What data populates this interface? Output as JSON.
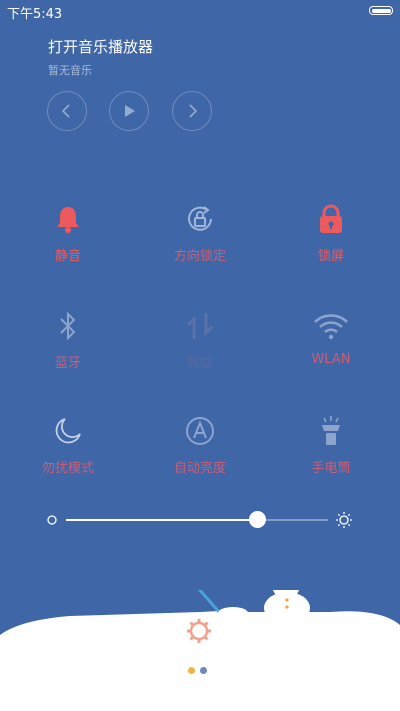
{
  "status_bar": {
    "time": "下午5:43"
  },
  "music": {
    "title": "打开音乐播放器",
    "subtitle": "暂无音乐",
    "controls": [
      "previous-icon",
      "play-icon",
      "next-icon"
    ]
  },
  "toggles": [
    {
      "label": "静音",
      "icon": "bell-icon",
      "color": "#ec5a5e",
      "active": true
    },
    {
      "label": "方向锁定",
      "icon": "rotation-lock-icon",
      "color": "#c75f79",
      "active": false
    },
    {
      "label": "锁屏",
      "icon": "padlock-icon",
      "color": "#ec5a5e",
      "active": true
    },
    {
      "label": "蓝牙",
      "icon": "bluetooth-icon",
      "color": "#c75f79",
      "active": false
    },
    {
      "label": "数据",
      "icon": "data-arrows-icon",
      "color": "#5669a2",
      "active": false
    },
    {
      "label": "WLAN",
      "icon": "wifi-icon",
      "color": "#c75f79",
      "active": false
    },
    {
      "label": "勿扰模式",
      "icon": "moon-icon",
      "color": "#c75f79",
      "active": false
    },
    {
      "label": "自动亮度",
      "icon": "auto-brightness-icon",
      "color": "#c75f79",
      "active": false
    },
    {
      "label": "手电筒",
      "icon": "flashlight-icon",
      "color": "#c75f79",
      "active": false
    }
  ],
  "brightness": {
    "level": 0.73
  },
  "pager": {
    "pages": 2,
    "current": 0,
    "active_color": "#f0b33c",
    "inactive_color": "#6e86bd"
  },
  "colors": {
    "background": "#3f66a6",
    "accent_red": "#ec5a5e",
    "snow": "#ffffff"
  }
}
